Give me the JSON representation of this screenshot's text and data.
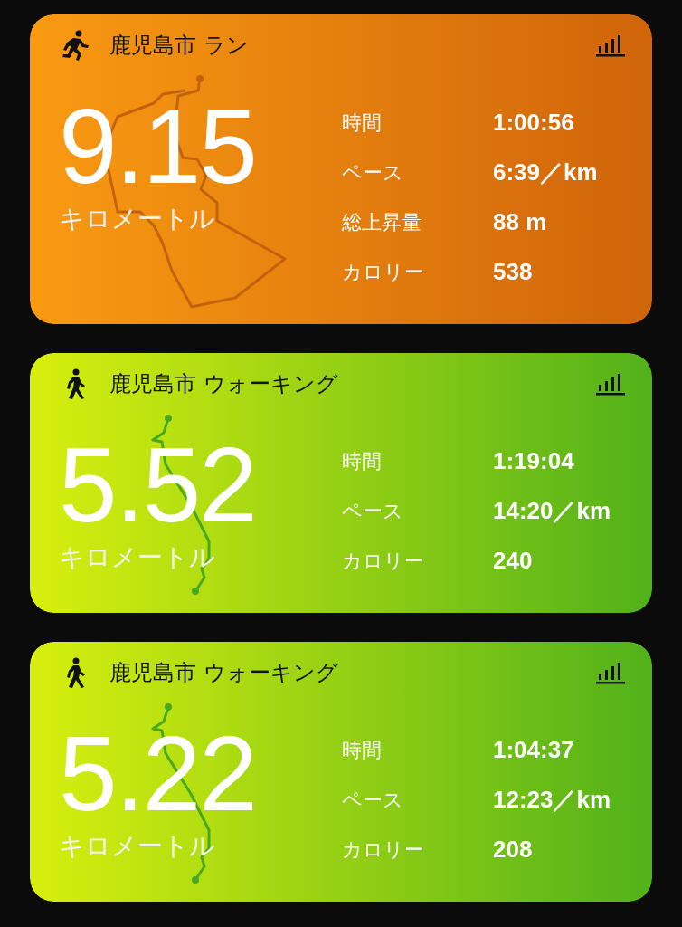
{
  "workouts": [
    {
      "kind": "run",
      "title": "鹿児島市 ラン",
      "distance": "9.15",
      "unit": "キロメートル",
      "stats": [
        {
          "label": "時間",
          "value": "1:00:56"
        },
        {
          "label": "ペース",
          "value": "6:39／km"
        },
        {
          "label": "総上昇量",
          "value": "88 m"
        },
        {
          "label": "カロリー",
          "value": "538"
        }
      ]
    },
    {
      "kind": "walk",
      "title": "鹿児島市 ウォーキング",
      "distance": "5.52",
      "unit": "キロメートル",
      "stats": [
        {
          "label": "時間",
          "value": "1:19:04"
        },
        {
          "label": "ペース",
          "value": "14:20／km"
        },
        {
          "label": "カロリー",
          "value": "240"
        }
      ]
    },
    {
      "kind": "walk",
      "title": "鹿児島市 ウォーキング",
      "distance": "5.22",
      "unit": "キロメートル",
      "stats": [
        {
          "label": "時間",
          "value": "1:04:37"
        },
        {
          "label": "ペース",
          "value": "12:23／km"
        },
        {
          "label": "カロリー",
          "value": "208"
        }
      ]
    }
  ]
}
